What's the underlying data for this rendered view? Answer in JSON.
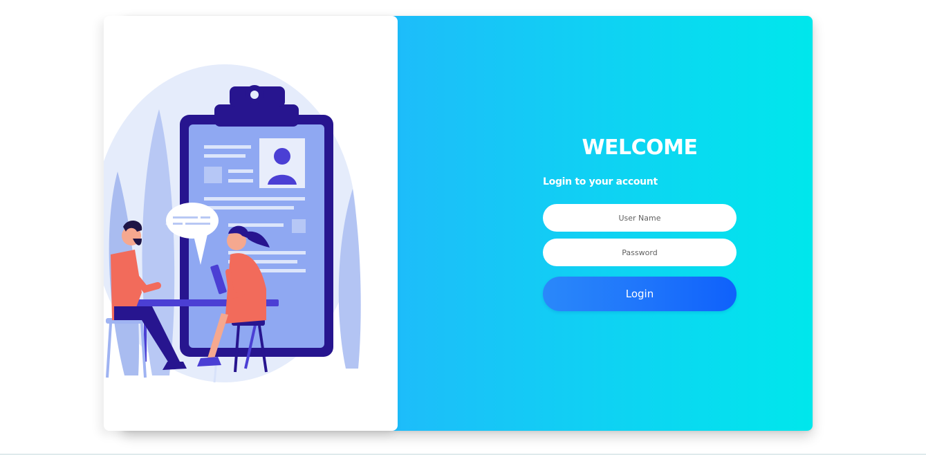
{
  "login_form": {
    "heading": "WELCOME",
    "subheading": "Login to your account",
    "username_placeholder": "User Name",
    "username_value": "",
    "password_placeholder": "Password",
    "password_value": "",
    "submit_label": "Login"
  },
  "theme": {
    "gradient_start": "#29aefe",
    "gradient_end": "#00e7ec",
    "button_start": "#2a88fa",
    "button_end": "#0f61fb",
    "illustration_primary": "#3e2fb8",
    "illustration_accent": "#f26b5b"
  },
  "illustration": {
    "description_icon": "interview-illustration-icon"
  }
}
